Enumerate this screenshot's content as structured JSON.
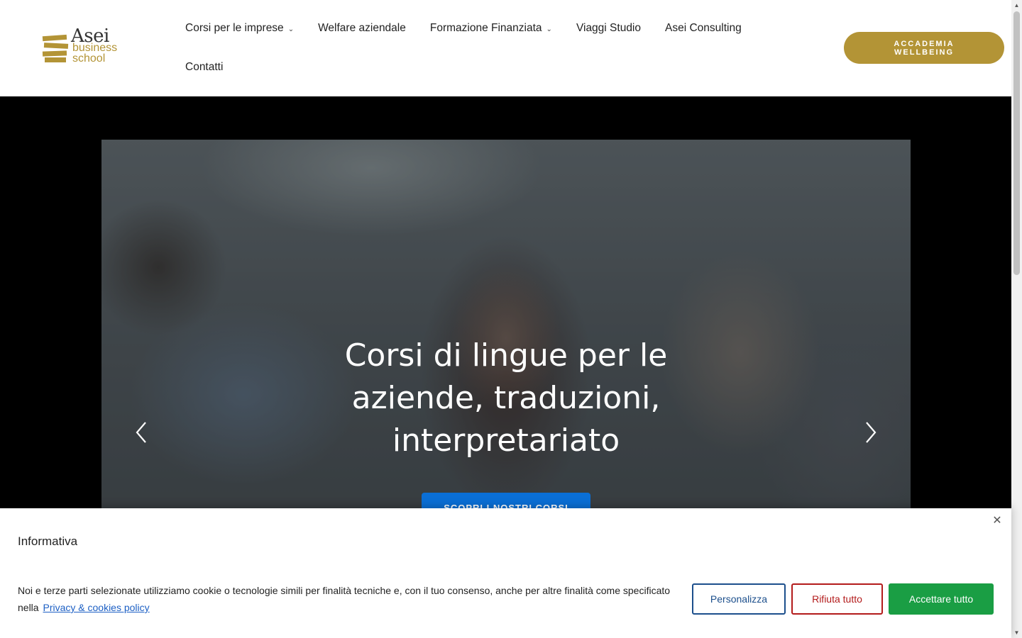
{
  "logo": {
    "word1": "Asei",
    "word2": "business",
    "word3": "school",
    "brand_color": "#b39436"
  },
  "nav": {
    "items": [
      {
        "label": "Corsi per le imprese",
        "has_dropdown": true
      },
      {
        "label": "Welfare aziendale",
        "has_dropdown": false
      },
      {
        "label": "Formazione Finanziata",
        "has_dropdown": true
      },
      {
        "label": "Viaggi Studio",
        "has_dropdown": false
      },
      {
        "label": "Asei Consulting",
        "has_dropdown": false
      },
      {
        "label": "Contatti",
        "has_dropdown": false
      }
    ],
    "dropdown_icon": "chevron-down-icon"
  },
  "cta": {
    "line1": "ACCADEMIA",
    "line2": "WELLBEING"
  },
  "hero": {
    "title": "Corsi di lingue per le aziende, traduzioni, interpretariato",
    "button_label": "SCOPRI I NOSTRI CORSI",
    "button_color": "#0a6fd6",
    "prev_icon": "chevron-left-icon",
    "next_icon": "chevron-right-icon"
  },
  "cookie": {
    "title": "Informativa",
    "text": "Noi e terze parti selezionate utilizziamo cookie o tecnologie simili per finalità tecniche e, con il tuo consenso, anche per altre finalità come specificato nella",
    "link": "Privacy & cookies policy",
    "close_icon": "close-icon",
    "buttons": {
      "personalizza": "Personalizza",
      "rifiuta": "Rifiuta tutto",
      "accetta": "Accettare tutto"
    },
    "colors": {
      "personalizza": "#1c4f8c",
      "rifiuta": "#b31b1b",
      "accetta": "#1a9e44"
    }
  }
}
